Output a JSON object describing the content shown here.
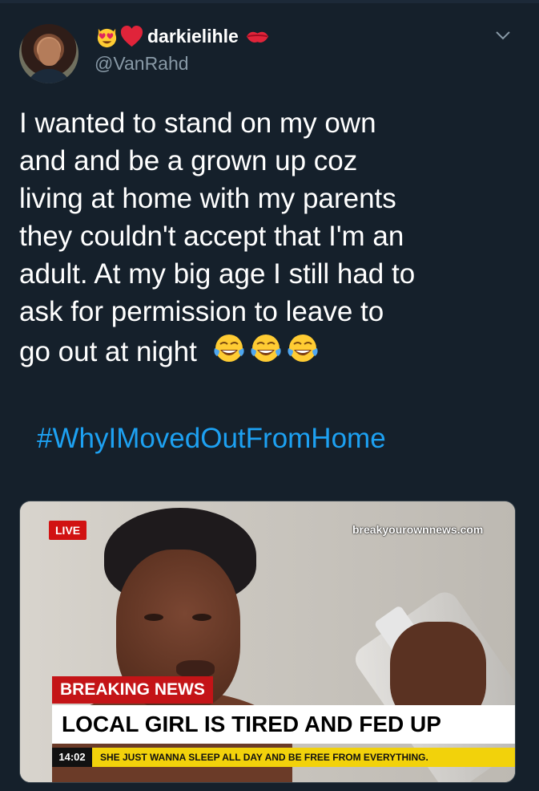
{
  "tweet": {
    "author": {
      "display_name": "darkielihle",
      "handle": "@VanRahd",
      "name_emojis": [
        "heart-eyes-cat-emoji",
        "red-heart-emoji"
      ],
      "trailing_emoji": "kiss-lips-emoji"
    },
    "text": "I wanted to stand on my own\nand and be a grown up coz\nliving at home with my parents\nthey couldn't accept that I'm an\nadult. At my big age I still had to\nask for permission to leave to\ngo out at night",
    "text_emojis": [
      "tears-of-joy-emoji",
      "tears-of-joy-emoji",
      "tears-of-joy-emoji"
    ],
    "hashtag": "#WhyIMovedOutFromHome"
  },
  "media": {
    "live_label": "LIVE",
    "watermark": "breakyourownnews.com",
    "breaking_label": "BREAKING NEWS",
    "headline": "LOCAL GIRL IS TIRED AND FED UP",
    "time": "14:02",
    "ticker": "SHE JUST WANNA SLEEP ALL DAY AND BE FREE FROM EVERYTHING."
  },
  "colors": {
    "background": "#15202b",
    "text": "#ffffff",
    "muted": "#8899a6",
    "link": "#1da1f2",
    "breaking_red": "#c41417",
    "ticker_yellow": "#f2d20b"
  }
}
